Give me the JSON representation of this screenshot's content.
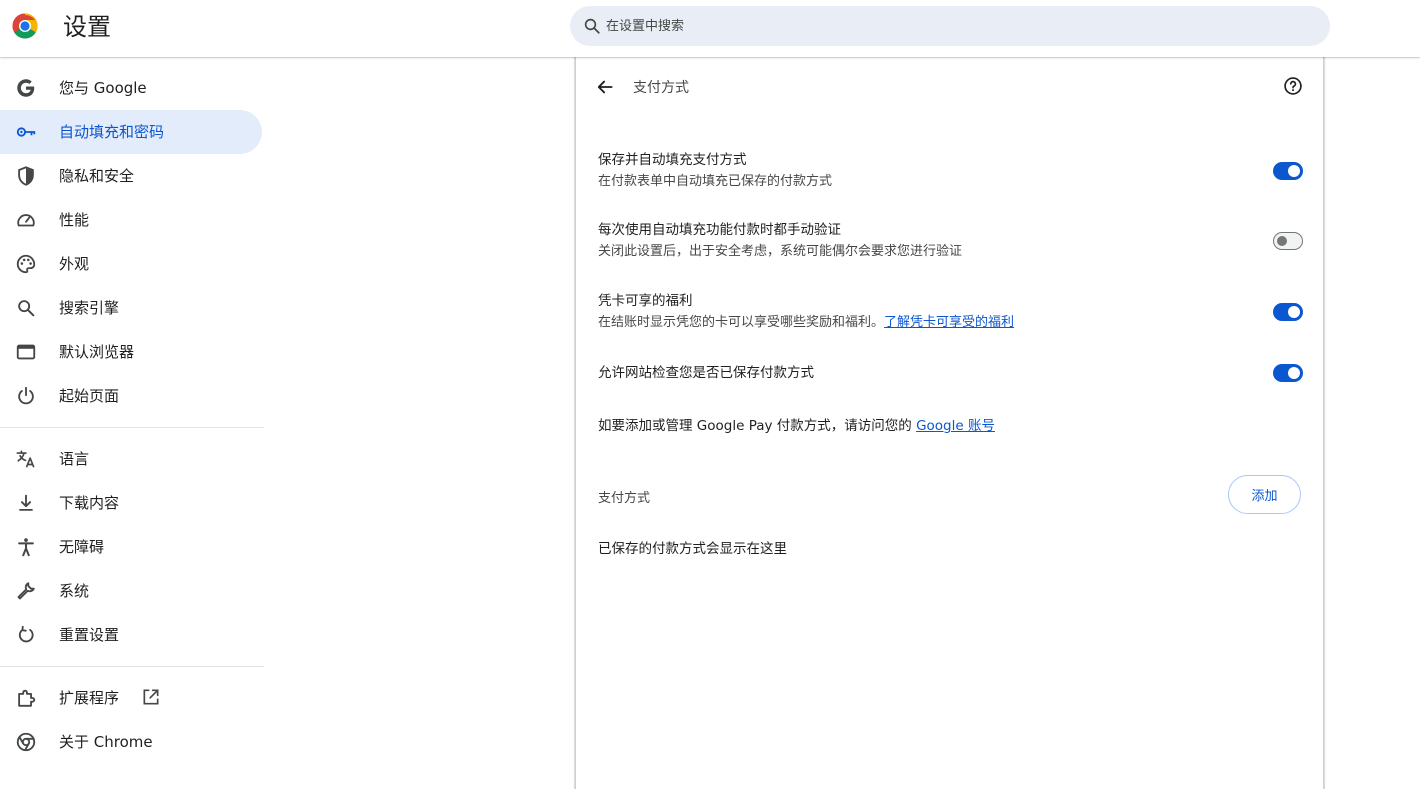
{
  "header": {
    "title": "设置",
    "search_placeholder": "在设置中搜索",
    "search_value": ""
  },
  "sidebar": {
    "items": [
      {
        "label": "您与 Google",
        "icon": "google-g-icon"
      },
      {
        "label": "自动填充和密码",
        "icon": "key-icon",
        "active": true
      },
      {
        "label": "隐私和安全",
        "icon": "shield-icon"
      },
      {
        "label": "性能",
        "icon": "speedometer-icon"
      },
      {
        "label": "外观",
        "icon": "palette-icon"
      },
      {
        "label": "搜索引擎",
        "icon": "search-icon"
      },
      {
        "label": "默认浏览器",
        "icon": "browser-window-icon"
      },
      {
        "label": "起始页面",
        "icon": "power-icon"
      },
      {
        "label": "语言",
        "icon": "translate-icon"
      },
      {
        "label": "下载内容",
        "icon": "download-icon"
      },
      {
        "label": "无障碍",
        "icon": "accessibility-icon"
      },
      {
        "label": "系统",
        "icon": "wrench-icon"
      },
      {
        "label": "重置设置",
        "icon": "reset-icon"
      },
      {
        "label": "扩展程序",
        "icon": "puzzle-icon"
      },
      {
        "label": "关于 Chrome",
        "icon": "chrome-icon"
      }
    ]
  },
  "main": {
    "page_title": "支付方式",
    "settings": [
      {
        "title": "保存并自动填充支付方式",
        "subtitle": "在付款表单中自动填充已保存的付款方式",
        "enabled": true
      },
      {
        "title": "每次使用自动填充功能付款时都手动验证",
        "subtitle": "关闭此设置后，出于安全考虑，系统可能偶尔会要求您进行验证",
        "enabled": false
      },
      {
        "title": "凭卡可享的福利",
        "subtitle": "在结账时显示凭您的卡可以享受哪些奖励和福利。",
        "link": "了解凭卡可享受的福利",
        "enabled": true
      },
      {
        "title": "允许网站检查您是否已保存付款方式",
        "enabled": true
      }
    ],
    "google_pay_text": "如要添加或管理 Google Pay 付款方式，请访问您的",
    "google_pay_link": "Google 账号",
    "section_title": "支付方式",
    "add_label": "添加",
    "empty_text": "已保存的付款方式会显示在这里"
  },
  "colors": {
    "accent": "#0b57d0",
    "active_nav_bg": "#e3ecfb",
    "search_bg": "#e9eef6"
  }
}
